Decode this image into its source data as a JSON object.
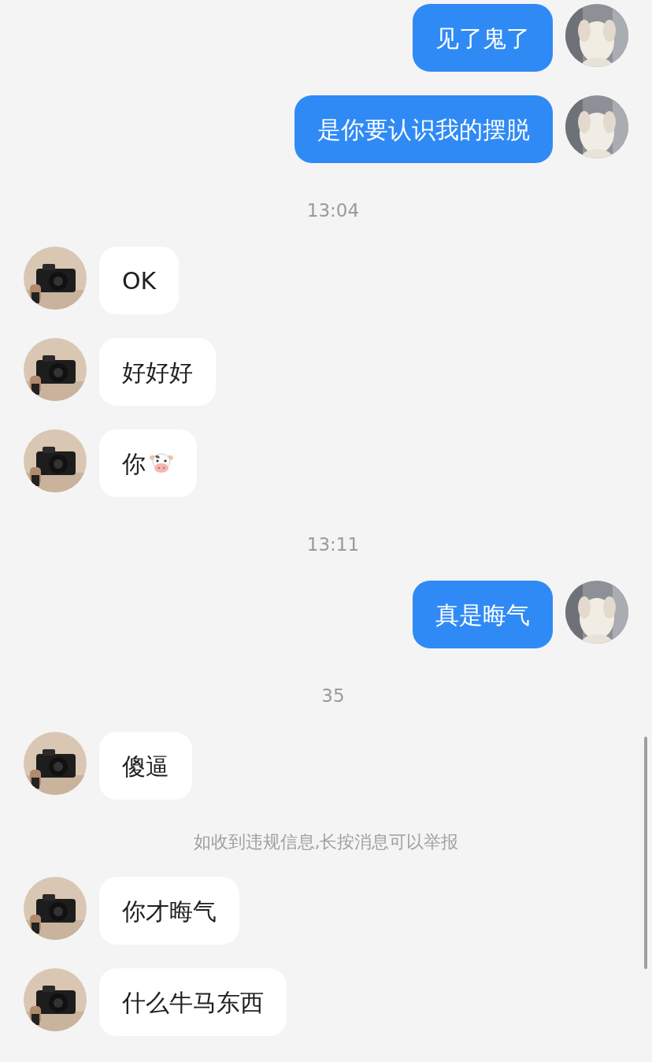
{
  "messages": [
    {
      "kind": "sent",
      "text": "见了鬼了"
    },
    {
      "kind": "sent",
      "text": "是你要认识我的摆脱"
    },
    {
      "kind": "time",
      "text": "13:04"
    },
    {
      "kind": "received",
      "text": "OK"
    },
    {
      "kind": "received",
      "text": "好好好"
    },
    {
      "kind": "received",
      "text": "你",
      "sticker": true
    },
    {
      "kind": "time",
      "text": "13:11"
    },
    {
      "kind": "sent",
      "text": "真是晦气"
    },
    {
      "kind": "time",
      "text": "35"
    },
    {
      "kind": "received",
      "text": "傻逼"
    },
    {
      "kind": "notice",
      "text": "如收到违规信息,长按消息可以举报"
    },
    {
      "kind": "received",
      "text": "你才晦气"
    },
    {
      "kind": "received",
      "text": "什么牛马东西"
    }
  ]
}
